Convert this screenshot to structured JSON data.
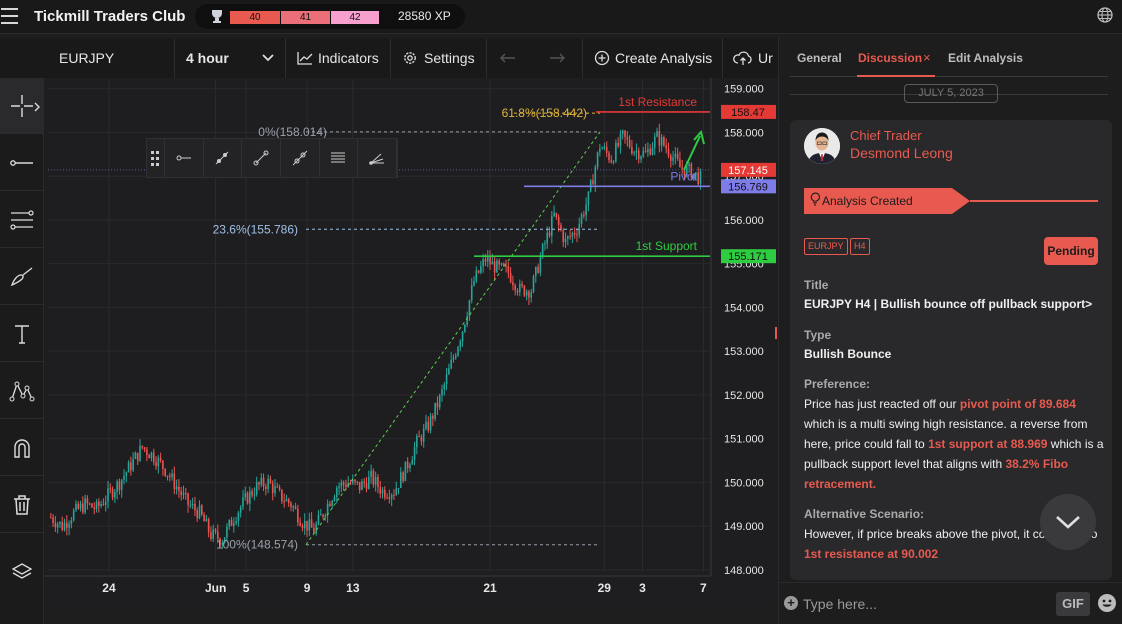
{
  "app": {
    "title": "Tickmill Traders Club",
    "levels": [
      "40",
      "41",
      "42"
    ],
    "level_colors": [
      "#e85a4f",
      "#ea6f78",
      "#f7a0cd"
    ],
    "xp": "28580 XP",
    "icons": [
      "menu-icon",
      "trophy-icon",
      "globe-icon"
    ]
  },
  "toolbar": {
    "symbol": "EURJPY",
    "timeframe": "4 hour",
    "indicators": "Indicators",
    "settings": "Settings",
    "create": "Create Analysis",
    "upload": "Ur"
  },
  "leftbar": {
    "tools": [
      "crosshair-icon",
      "horizontal-line-icon",
      "fib-retracement-icon",
      "brush-icon",
      "text-icon",
      "pattern-icon",
      "magnet-icon",
      "trash-icon",
      "layers-icon"
    ]
  },
  "chart_data": {
    "type": "candlestick",
    "symbol": "EURJPY",
    "timeframe": "4 hour",
    "ylim": [
      147.95,
      159.2
    ],
    "y_ticks": [
      "159.000",
      "158.000",
      "157.000",
      "156.000",
      "155.000",
      "154.000",
      "153.000",
      "152.000",
      "151.000",
      "150.000",
      "149.000",
      "148.000"
    ],
    "x_ticks": [
      "24",
      "Jun",
      "5",
      "9",
      "13",
      "21",
      "29",
      "3",
      "7"
    ],
    "x_tick_positions": [
      0.08,
      0.22,
      0.26,
      0.34,
      0.4,
      0.58,
      0.73,
      0.78,
      0.86
    ],
    "up_color": "#26a69a",
    "down_color": "#ef5350",
    "closes": [
      149.2,
      149.0,
      149.3,
      149.5,
      149.4,
      149.7,
      150.0,
      150.4,
      150.8,
      150.6,
      150.3,
      149.9,
      149.5,
      149.3,
      148.8,
      148.7,
      149.2,
      149.6,
      149.9,
      150.0,
      149.7,
      149.5,
      149.1,
      148.9,
      149.4,
      149.9,
      150.0,
      149.9,
      150.1,
      149.8,
      149.8,
      150.3,
      150.9,
      151.3,
      151.9,
      152.7,
      153.5,
      154.6,
      155.1,
      154.9,
      154.8,
      154.4,
      154.4,
      155.3,
      156.1,
      155.5,
      155.8,
      156.5,
      157.7,
      157.4,
      157.9,
      157.6,
      157.5,
      157.9,
      157.6,
      157.2,
      157.1,
      156.9
    ],
    "levels": [
      {
        "label": "1st Resistance",
        "price": 158.47,
        "tag": "158.47",
        "color": "#e53935"
      },
      {
        "label": "Pivot",
        "price": 156.769,
        "tag": "156.769",
        "color": "#7e7ce8"
      },
      {
        "label": "1st Support",
        "price": 155.171,
        "tag": "155.171",
        "color": "#2ecc40"
      }
    ],
    "current_price": 157.145,
    "current_price_tag": "157.145",
    "fib": [
      {
        "label": "61.8%(158.442)",
        "price": 158.442,
        "color": "#e0b43c"
      },
      {
        "label": "0%(158.014)",
        "price": 158.014,
        "color": "#9aa0aa"
      },
      {
        "label": "23.6%(155.786)",
        "price": 155.786,
        "color": "#9fc0e6"
      },
      {
        "label": "100%(148.574)",
        "price": 148.574,
        "color": "#9aa0aa"
      }
    ]
  },
  "floatbar": {
    "tools": [
      "drag-handle-icon",
      "line-left-icon",
      "ray-icon",
      "segment-icon",
      "extended-line-icon",
      "parallel-lines-icon",
      "fan-icon"
    ]
  },
  "panel": {
    "tabs": [
      "General",
      "Discussion",
      "Edit Analysis"
    ],
    "close_glyph": "×",
    "date": "JULY 5, 2023",
    "role": "Chief Trader",
    "author": "Desmond Leong",
    "banner": "Analysis Created",
    "chips": [
      "EURJPY",
      "H4"
    ],
    "status": "Pending",
    "title_label": "Title",
    "title": "EURJPY H4 | Bullish bounce off pullback support>",
    "type_label": "Type",
    "type": "Bullish Bounce",
    "pref_label": "Preference:",
    "pref_1": "Price has just reacted off our ",
    "pref_2": "pivot point of 89.684",
    "pref_3": " which is a multi swing high resistance. a reverse from here, price could fall to ",
    "pref_4": "1st support at 88.969",
    "pref_5": " which is a pullback support level that aligns with ",
    "pref_6": "38.2% Fibo retracement.",
    "alt_label": "Alternative Scenario:",
    "alt_1": "However, if price breaks above the pivot, it could rise to ",
    "alt_2": "1st resistance at 90.002",
    "input_placeholder": "Type here...",
    "gif": "GIF"
  }
}
